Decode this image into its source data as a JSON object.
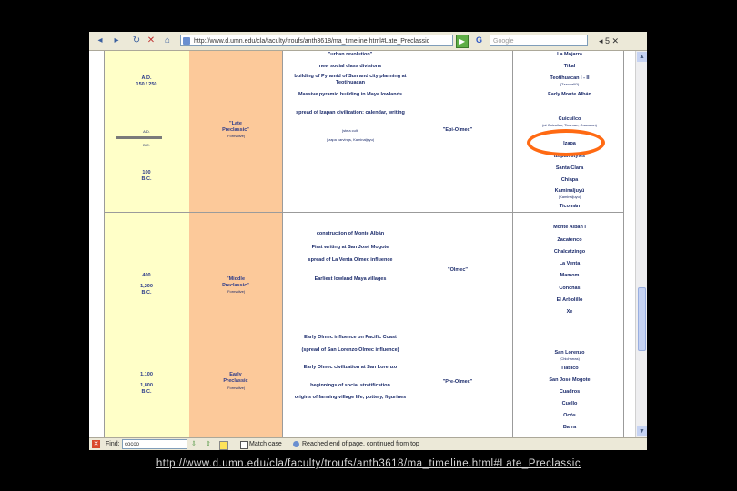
{
  "browser": {
    "nav": {
      "back": "◂",
      "forward": "▸",
      "reload": "↻",
      "stop": "✕",
      "home": "⌂"
    },
    "address": "http://www.d.umn.edu/cla/faculty/troufs/anth3618/ma_timeline.html#Late_Preclassic",
    "go": "▶",
    "search_logo": "G",
    "search_placeholder": "Google",
    "tab_controls": "◂ 5 ✕"
  },
  "table": {
    "row1": {
      "dates": [
        "A.D.",
        "150 / 250"
      ],
      "ad_bc": [
        "A.D.",
        "B.C."
      ],
      "date_100": [
        "100",
        "B.C."
      ],
      "period": "\"Late\nPreclassic\"",
      "period_sub": "(Formative)",
      "culture": "\"Epi-Olmec\"",
      "events": [
        "\"urban revolution\"",
        "new social class divisions",
        "building of Pyramid of Sun and city planning at Teotihuacan",
        "Massive pyramid building in Maya lowlands",
        "spread of Izapan civilization: calendar, writing"
      ],
      "events_small": [
        "(stela cult)",
        "(Izapa carvings, Kaminaljuyu)"
      ],
      "sites": [
        "La Mojarra",
        "Tikal",
        "Teotihuacan I - II",
        "Early Monte Albán",
        "Cuicuilco",
        "Izapa",
        "Izapan styles",
        "Santa Clara",
        "Chiapa",
        "Kaminaljuyú",
        "Ticomán"
      ],
      "sites_small": [
        "(Tzacualli?)",
        "(at Cuicuilco, Ticoman, Cuanalan)",
        "(Kaminaljuyu)",
        "(Miraflores)"
      ]
    },
    "row2": {
      "dates": [
        "400",
        "1,200",
        "B.C."
      ],
      "period": "\"Middle\nPreclassic\"",
      "period_sub": "(Formative)",
      "culture": "\"Olmec\"",
      "events": [
        "construction of Monte Albán",
        "First writing at San José Mogote",
        "spread of La Venta Olmec influence",
        "Earliest lowland Maya villages"
      ],
      "sites": [
        "Monte Albán I",
        "Zacatenco",
        "Chalcatzingo",
        "La Venta",
        "Mamom",
        "Conchas",
        "El Arbolillo",
        "Xe"
      ]
    },
    "row3": {
      "dates": [
        "1,100",
        "1,800",
        "B.C."
      ],
      "period": "Early\nPreclassic",
      "period_sub": "(Formative)",
      "culture": "\"Pre-Olmec\"",
      "events": [
        "Early Olmec influence on Pacific Coast",
        "(spread of San Lorenzo Olmec influence)",
        "Early Olmec civilization at San Lorenzo",
        "beginnings of social stratification",
        "origins of farming village life, pottery, figurines"
      ],
      "sites": [
        "San Lorenzo",
        "Tlatilco",
        "San José Mogote",
        "Cuadros",
        "Cuello",
        "Ocós",
        "Barra"
      ],
      "sites_small": [
        "(Chicharras)"
      ]
    }
  },
  "findbar": {
    "label": "Find:",
    "value": "cocoo",
    "next": "⇩",
    "prev": "⇧",
    "highlight": "",
    "match_case": "Match case",
    "status": "Reached end of page, continued from top"
  },
  "caption_url": "http://www.d.umn.edu/cla/faculty/troufs/anth3618/ma_timeline.html#Late_Preclassic"
}
